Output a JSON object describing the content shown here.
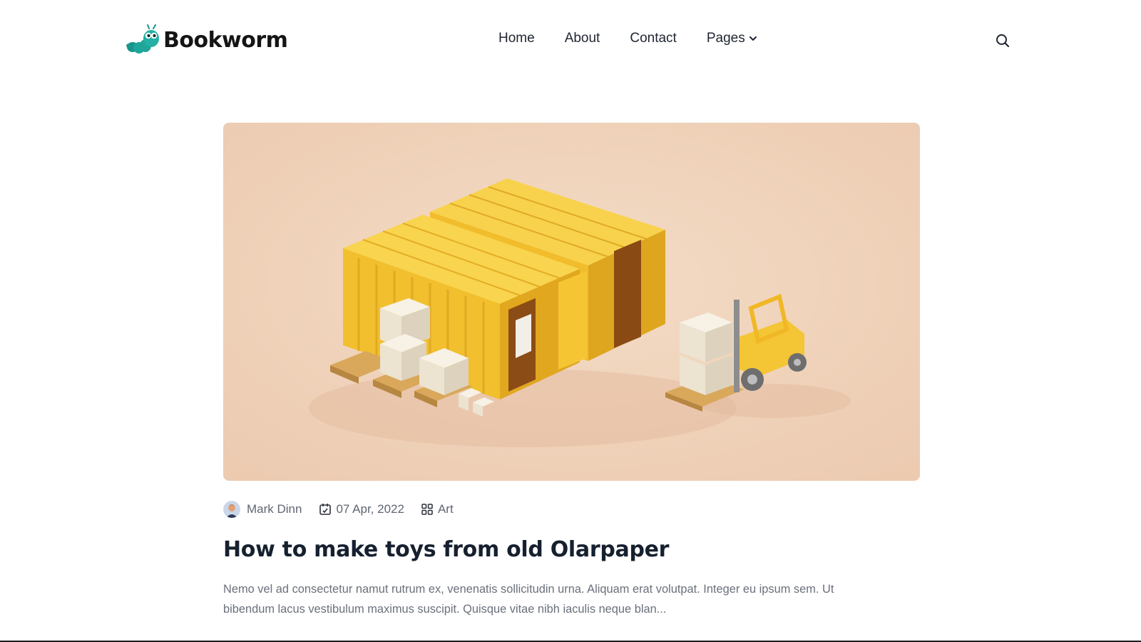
{
  "brand": {
    "name": "Bookworm",
    "logo_icon": "bookworm-caterpillar-icon",
    "logo_color": "#1fa59a"
  },
  "nav": {
    "items": [
      {
        "label": "Home"
      },
      {
        "label": "About"
      },
      {
        "label": "Contact"
      },
      {
        "label": "Pages",
        "icon": "chevron-down-icon"
      }
    ]
  },
  "header": {
    "search_icon": "search-icon"
  },
  "post": {
    "image": {
      "subject": "yellow shipping containers with boxes and forklift",
      "background": "#f2d6c1"
    },
    "author": "Mark Dinn",
    "date": "07 Apr, 2022",
    "category": "Art",
    "title": "How to make toys from old Olarpaper",
    "excerpt": "Nemo vel ad consectetur namut rutrum ex, venenatis sollicitudin urna. Aliquam erat volutpat. Integer eu ipsum sem. Ut bibendum lacus vestibulum maximus suscipit. Quisque vitae nibh iaculis neque blan..."
  },
  "colors": {
    "text_dark": "#16202f",
    "text_muted": "#6a707b",
    "container_yellow": "#f6c533"
  }
}
